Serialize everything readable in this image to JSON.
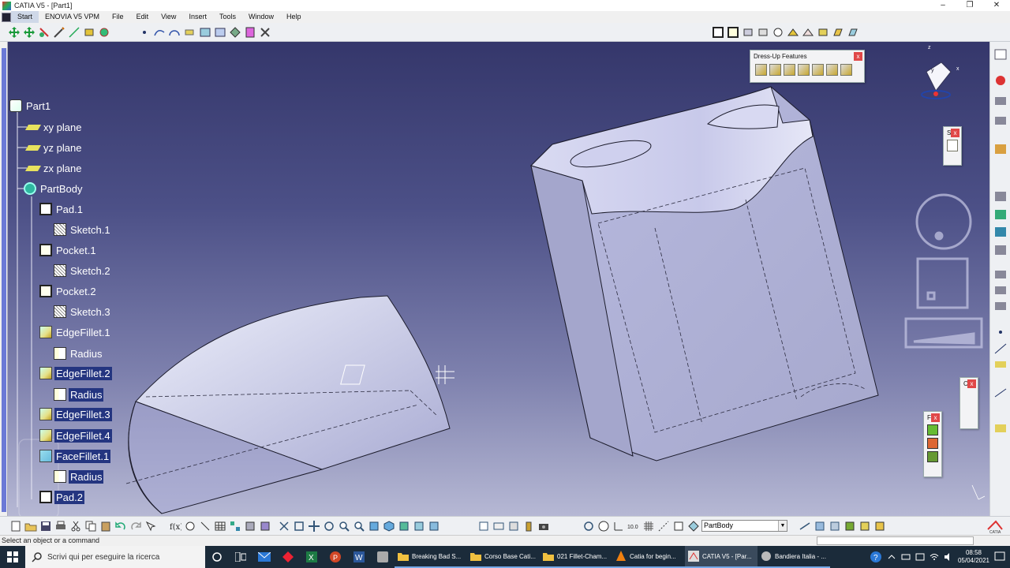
{
  "window": {
    "title": "CATIA V5 - [Part1]",
    "controls": [
      "–",
      "❐",
      "✕"
    ]
  },
  "menu": [
    "Start",
    "ENOVIA V5 VPM",
    "File",
    "Edit",
    "View",
    "Insert",
    "Tools",
    "Window",
    "Help"
  ],
  "tree": {
    "root": "Part1",
    "nodes": [
      {
        "label": "xy plane",
        "icon": "plane-icon"
      },
      {
        "label": "yz plane",
        "icon": "plane-icon"
      },
      {
        "label": "zx plane",
        "icon": "plane-icon"
      },
      {
        "label": "PartBody",
        "icon": "body-icon"
      },
      {
        "label": "Pad.1",
        "icon": "pad-icon"
      },
      {
        "label": "Sketch.1",
        "icon": "sketch-icon"
      },
      {
        "label": "Pocket.1",
        "icon": "pocket-icon"
      },
      {
        "label": "Sketch.2",
        "icon": "sketch-icon"
      },
      {
        "label": "Pocket.2",
        "icon": "pocket-icon"
      },
      {
        "label": "Sketch.3",
        "icon": "sketch-icon"
      },
      {
        "label": "EdgeFillet.1",
        "icon": "edge-fillet-icon"
      },
      {
        "label": "Radius",
        "icon": "radius-icon"
      },
      {
        "label": "EdgeFillet.2",
        "icon": "edge-fillet-icon"
      },
      {
        "label": "Radius",
        "icon": "radius-icon"
      },
      {
        "label": "EdgeFillet.3",
        "icon": "edge-fillet-icon"
      },
      {
        "label": "EdgeFillet.4",
        "icon": "edge-fillet-icon"
      },
      {
        "label": "FaceFillet.1",
        "icon": "face-fillet-icon"
      },
      {
        "label": "Radius",
        "icon": "radius-icon"
      },
      {
        "label": "Pad.2",
        "icon": "pad-icon"
      }
    ]
  },
  "dressup": {
    "title": "Dress-Up Features",
    "close": "x"
  },
  "mini_toolbars": {
    "s_label": "S",
    "f_label": "F",
    "c_label": "C",
    "close": "x"
  },
  "compass": {
    "x": "x",
    "y": "y",
    "z": "z"
  },
  "bottom_toolbar": {
    "current_body": "PartBody",
    "dropdown": "▼"
  },
  "status": {
    "text": "Select an object or a command"
  },
  "taskbar": {
    "search_placeholder": "Scrivi qui per eseguire la ricerca",
    "apps": [
      {
        "label": "Breaking Bad S...",
        "icon": "folder-icon"
      },
      {
        "label": "Corso Base Cati...",
        "icon": "folder-icon"
      },
      {
        "label": "021 Fillet-Cham...",
        "icon": "folder-icon"
      },
      {
        "label": "Catia for begin...",
        "icon": "vlc-icon"
      },
      {
        "label": "CATIA V5 - [Par...",
        "icon": "catia-icon"
      },
      {
        "label": "Bandiera Italia - ...",
        "icon": "app-icon"
      }
    ],
    "time": "08:58",
    "date": "05/04/2021"
  },
  "colors": {
    "viewport_top": "#35376b",
    "viewport_bottom": "#b6b8d4",
    "selection": "#243580",
    "taskbar": "#1b2b3a"
  }
}
